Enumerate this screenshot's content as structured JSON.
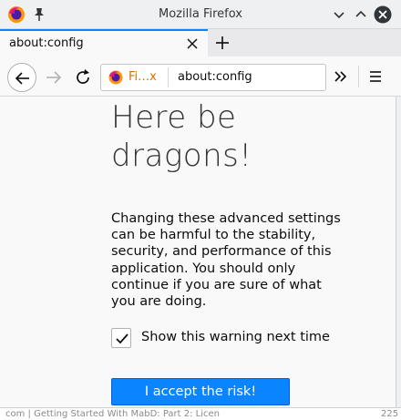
{
  "window": {
    "title": "Mozilla Firefox",
    "icon": "firefox-logo-icon",
    "pin_icon": "pin-icon",
    "controls": [
      "minimize-icon",
      "maximize-icon",
      "close-icon"
    ]
  },
  "tabs": [
    {
      "label": "about:config",
      "active": true
    }
  ],
  "navbar": {
    "identity_label": "Fi…x",
    "url": "about:config",
    "buttons": [
      "back-arrow-icon",
      "forward-arrow-icon",
      "reload-icon",
      "overflow-chevrons-icon",
      "hamburger-menu-icon"
    ]
  },
  "page": {
    "heading": "Here be dragons!",
    "warning": "Changing these advanced settings can be harmful to the stability, security, and performance of this application. You should only continue if you are sure of what you are doing.",
    "checkbox": {
      "label": "Show this warning next time",
      "checked": true
    },
    "accept_button": "I accept the risk!"
  },
  "background_window": {
    "partial_text": "com | Getting Started With MabD: Part 2: Licen",
    "partial_number": "225"
  },
  "colors": {
    "accent": "#0a84ff",
    "identity": "#d76e00",
    "page_bg": "#f9f9fa"
  }
}
